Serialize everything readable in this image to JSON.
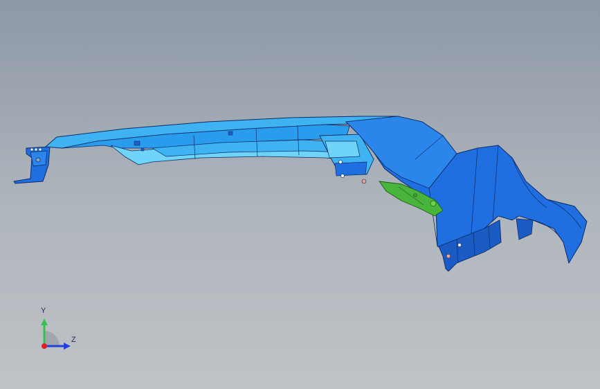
{
  "viewport": {
    "background_top": "#8d98a6",
    "background_bottom": "#bfc2c6"
  },
  "model": {
    "colors": {
      "primary_blue": "#1f6fe0",
      "light_blue": "#3fb3f2",
      "pale_cyan": "#6fd4f7",
      "dark_edge": "#0c2b66",
      "green_part": "#48b43c",
      "dark_green": "#1e5a1a"
    }
  },
  "triad": {
    "y_label": "Y",
    "z_label": "Z",
    "y_color": "#33c24a",
    "z_color": "#2440e0",
    "origin_color": "#e02020"
  }
}
